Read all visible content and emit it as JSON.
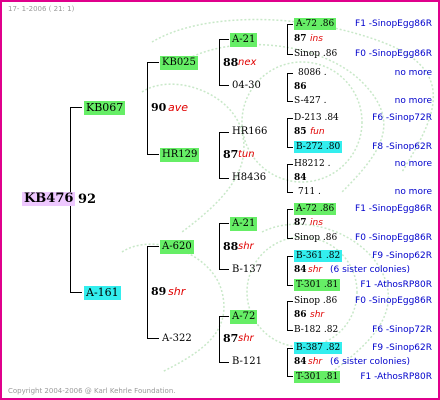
{
  "header": {
    "date": "17-  1-2006 ( 21: 1)"
  },
  "footer": {
    "copyright": "Copyright 2004-2006 @ Karl Kehrle Foundation."
  },
  "colors": {
    "frame": "#e0008c",
    "highlight_green": "#66ee66",
    "highlight_cyan": "#33eeee",
    "highlight_violet": "#eec8ff",
    "breeder_text": "#0000cc",
    "race_text": "#e00000"
  },
  "queen": {
    "name": "KB476",
    "year": "92"
  },
  "gen1": {
    "top": {
      "name": "KB067",
      "year": "90",
      "race": "ave"
    },
    "bottom": {
      "name": "A-161",
      "year": "89",
      "race": "shr"
    }
  },
  "gen2": {
    "g1": {
      "name": "KB025",
      "year": "88",
      "race": "nex"
    },
    "g2": {
      "name": "HR129",
      "year": "87",
      "race": "tun"
    },
    "g3": {
      "name": "A-620",
      "year": "88",
      "race": "shr"
    },
    "g4": {
      "name": "A-322",
      "year": "87",
      "race": "shr"
    }
  },
  "gen3": {
    "p1": {
      "name": "A-21"
    },
    "p2": {
      "name": "04-30"
    },
    "p3": {
      "name": "HR166",
      "year": "85",
      "race": "fun"
    },
    "p4": {
      "name": "H8436",
      "year": "84"
    },
    "p5": {
      "name": "A-21"
    },
    "p6": {
      "name": "B-137"
    },
    "p7": {
      "name": "A-72"
    },
    "p8": {
      "name": "B-121"
    }
  },
  "gen4": [
    {
      "name": "A-72 .86",
      "breeder": "F1 -SinopEgg86R"
    },
    {
      "name": "87",
      "race": "ins"
    },
    {
      "name": "Sinop .86",
      "breeder": "F0 -SinopEgg86R"
    },
    {
      "name": "8086 .",
      "breeder": "no more"
    },
    {
      "name": "86"
    },
    {
      "name": "S-427 .",
      "breeder": "no more"
    },
    {
      "name": "D-213 .84",
      "breeder": "F6 -Sinop72R"
    },
    {
      "name": "85",
      "race": "fun"
    },
    {
      "name": "B-272 .80",
      "breeder": "F8 -Sinop62R"
    },
    {
      "name": "H8212 .",
      "breeder": "no more"
    },
    {
      "name": "84"
    },
    {
      "name": "711 .",
      "breeder": "no more"
    },
    {
      "name": "A-72 .86",
      "breeder": "F1 -SinopEgg86R"
    },
    {
      "name": "87",
      "race": "ins"
    },
    {
      "name": "Sinop .86",
      "breeder": "F0 -SinopEgg86R"
    },
    {
      "name": "B-361 .82",
      "breeder": "F9 -Sinop62R"
    },
    {
      "name": "84",
      "race": "shr",
      "note": "(6 sister colonies)"
    },
    {
      "name": "T-301 .81",
      "breeder": "F1 -AthosRP80R"
    },
    {
      "name": "Sinop .86",
      "breeder": "F0 -SinopEgg86R"
    },
    {
      "name": "86",
      "race": "shr"
    },
    {
      "name": "B-182 .82",
      "breeder": "F6 -Sinop72R"
    },
    {
      "name": "B-387 .82",
      "breeder": "F9 -Sinop62R"
    },
    {
      "name": "84",
      "race": "shr",
      "note": "(6 sister colonies)"
    },
    {
      "name": "T-301 .81",
      "breeder": "F1 -AthosRP80R"
    }
  ]
}
